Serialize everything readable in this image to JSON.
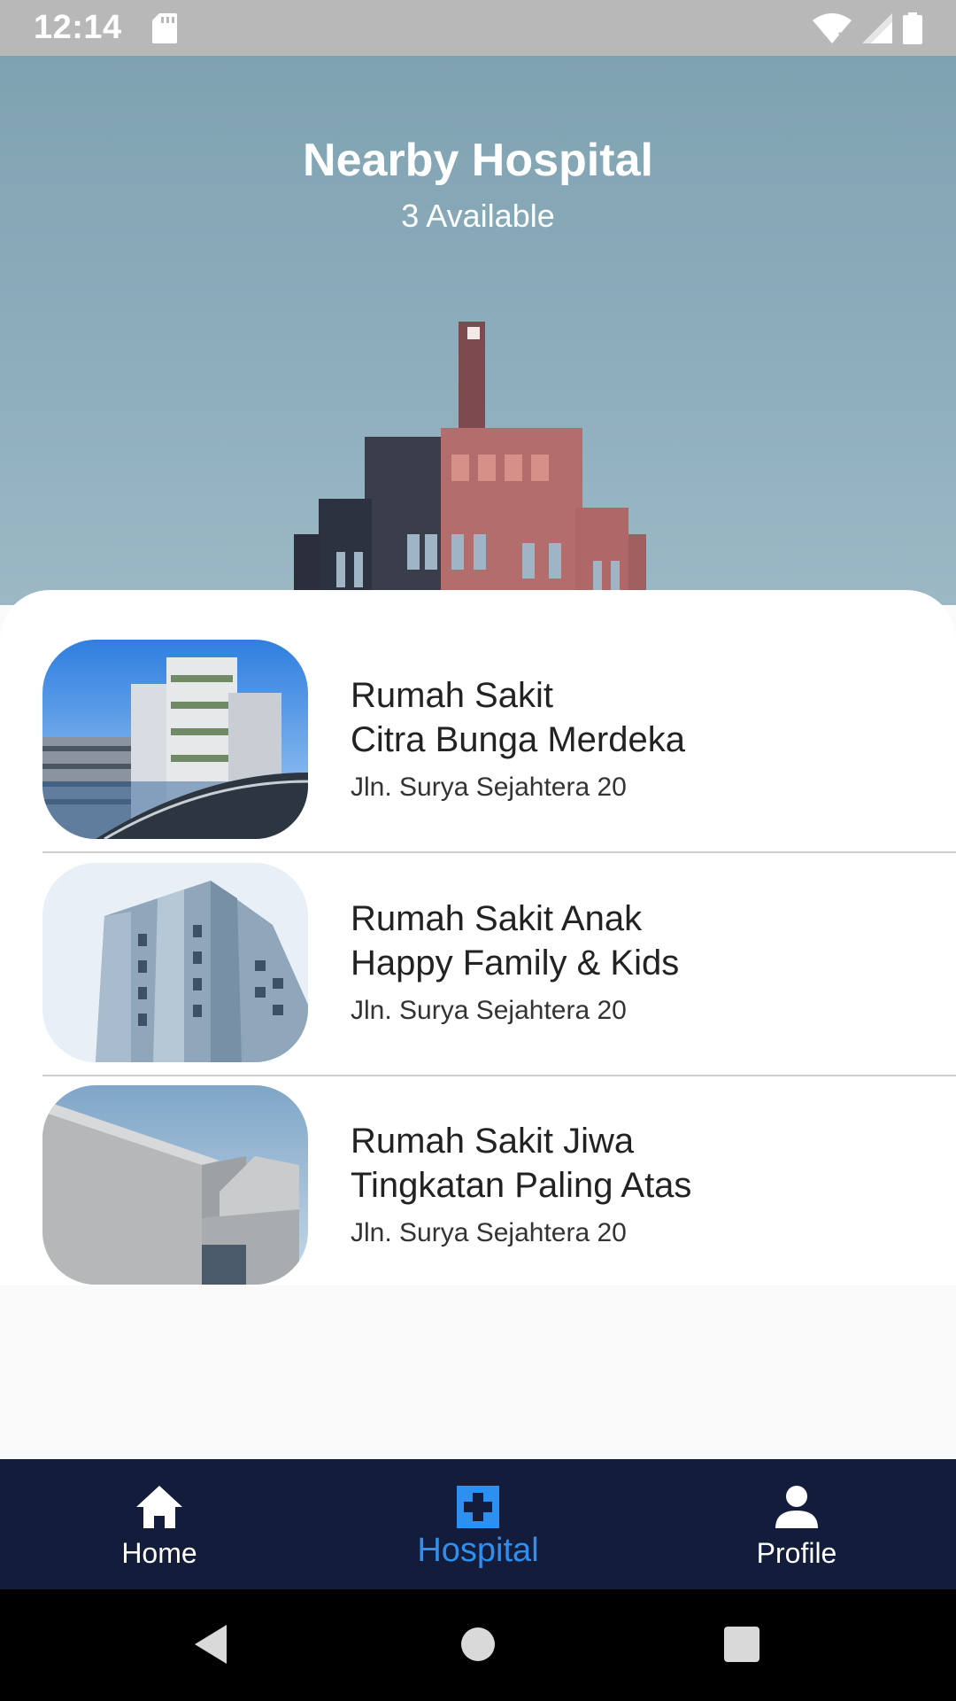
{
  "status_bar": {
    "time": "12:14"
  },
  "header": {
    "title": "Nearby Hospital",
    "subtitle": "3 Available"
  },
  "hospitals": [
    {
      "name_line1": "Rumah Sakit",
      "name_line2": "Citra Bunga Merdeka",
      "address": "Jln. Surya Sejahtera 20"
    },
    {
      "name_line1": "Rumah Sakit Anak",
      "name_line2": "Happy Family & Kids",
      "address": "Jln. Surya Sejahtera 20"
    },
    {
      "name_line1": "Rumah Sakit Jiwa",
      "name_line2": "Tingkatan Paling Atas",
      "address": "Jln. Surya Sejahtera 20"
    }
  ],
  "bottom_nav": {
    "items": [
      {
        "label": "Home",
        "icon": "home-icon"
      },
      {
        "label": "Hospital",
        "icon": "hospital-icon"
      },
      {
        "label": "Profile",
        "icon": "person-icon"
      }
    ],
    "active_index": 1,
    "active_color": "#2d8ff0",
    "background": "#131c3b"
  },
  "system_nav": {
    "buttons": [
      "back-icon",
      "home-circle-icon",
      "recents-icon"
    ]
  }
}
